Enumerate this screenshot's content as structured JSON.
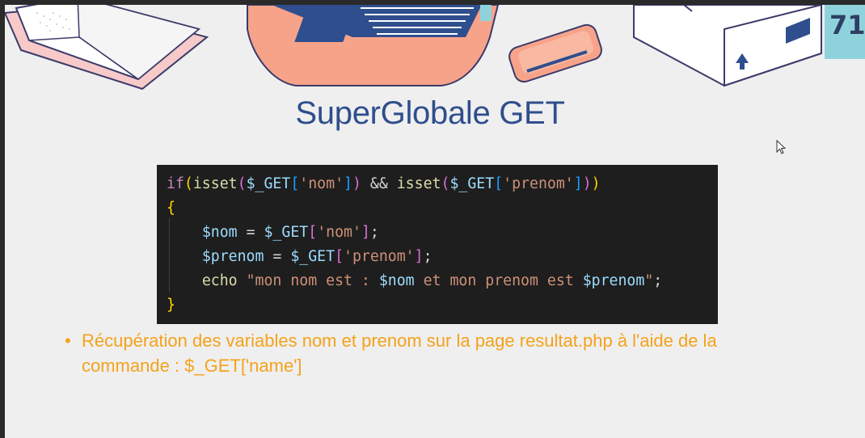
{
  "slide": {
    "number": "71",
    "title": "SuperGlobale GET"
  },
  "code": {
    "line1": {
      "if": "if",
      "isset1": "isset",
      "var1": "$_GET",
      "str1": "'nom'",
      "and": " && ",
      "isset2": "isset",
      "var2": "$_GET",
      "str2": "'prenom'"
    },
    "line2": {
      "brace": "{"
    },
    "line3": {
      "var": "$nom",
      "eq": " = ",
      "get": "$_GET",
      "str": "'nom'"
    },
    "line4": {
      "var": "$prenom",
      "eq": " = ",
      "get": "$_GET",
      "str": "'prenom'"
    },
    "line5": {
      "echo": "echo",
      "str_a": "\"mon nom est : ",
      "var_a": "$nom",
      "str_b": " et mon prenom est ",
      "var_b": "$prenom",
      "str_c": "\""
    },
    "line6": {
      "brace": "}"
    }
  },
  "bullet": {
    "marker": "•",
    "text": "Récupération des variables nom et prenom sur la page resultat.php à l'aide de la commande : $_GET['name']"
  },
  "colors": {
    "title": "#2f4e8d",
    "bullet": "#f4a21b",
    "code_bg": "#1e1e1e",
    "page_num_bg": "#8ed3dc"
  },
  "icons": [
    "book-illustration",
    "laptop-illustration",
    "phone-illustration",
    "box-illustration",
    "mouse-cursor-icon"
  ]
}
